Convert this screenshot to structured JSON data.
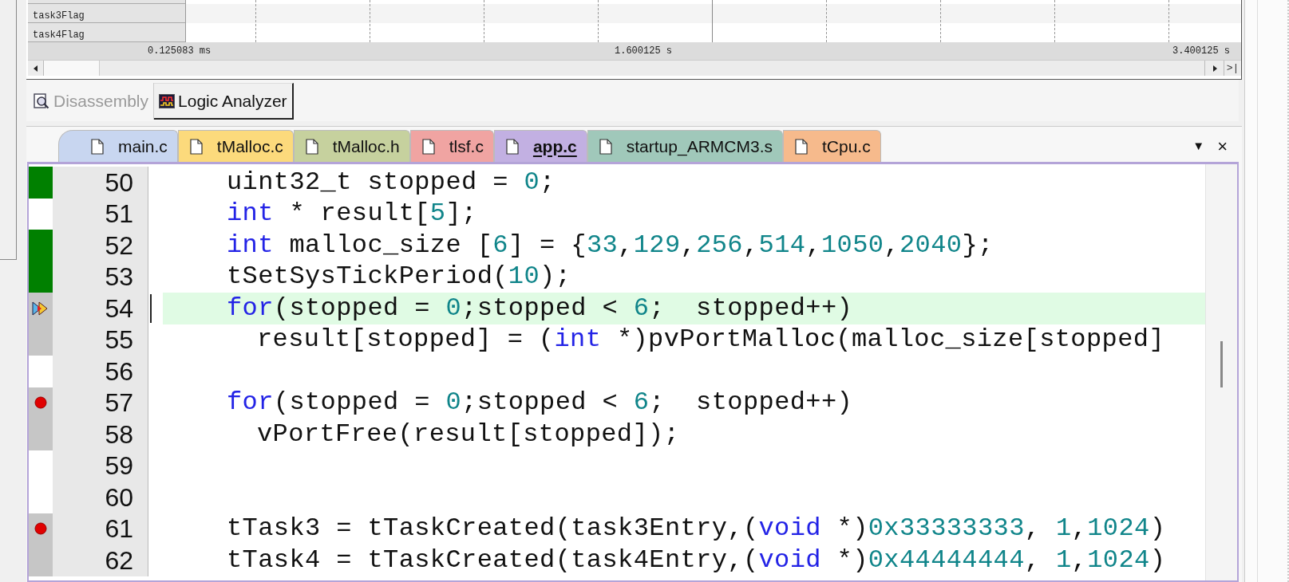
{
  "logic_analyzer": {
    "signals": [
      "task3Flag",
      "task4Flag"
    ],
    "time_labels": [
      "0.125083 ms",
      "1.600125 s",
      "3.400125 s"
    ],
    "scroll_end": ">|"
  },
  "panel_tabs": [
    {
      "label": "Disassembly",
      "selected": false,
      "kind": "disassembly"
    },
    {
      "label": "Logic Analyzer",
      "selected": true,
      "kind": "analyzer"
    }
  ],
  "editor_tabs": [
    {
      "label": "main.c",
      "selected": false,
      "color": "#c8d6f0"
    },
    {
      "label": "tMalloc.c",
      "selected": false,
      "color": "#fcda7c"
    },
    {
      "label": "tMalloc.h",
      "selected": false,
      "color": "#c6d19e"
    },
    {
      "label": "tlsf.c",
      "selected": false,
      "color": "#f0a4a2"
    },
    {
      "label": "app.c",
      "selected": true,
      "color": "#c2b0e2"
    },
    {
      "label": "startup_ARMCM3.s",
      "selected": false,
      "color": "#a0c8ba"
    },
    {
      "label": "tCpu.c",
      "selected": false,
      "color": "#f6ba8c"
    }
  ],
  "tab_controls": {
    "dropdown": "▼",
    "close": "×"
  },
  "lines": [
    {
      "number": "50",
      "kind": "statement",
      "covered": true,
      "breakpoint": false,
      "current": false,
      "segments": [
        {
          "text": "uint32_t stopped = ",
          "kind": "plain"
        },
        {
          "text": "0",
          "kind": "number"
        },
        {
          "text": ";",
          "kind": "plain"
        }
      ]
    },
    {
      "number": "51",
      "kind": "statement",
      "covered": false,
      "executed": false,
      "breakpoint": false,
      "current": false,
      "segments": [
        {
          "text": "int",
          "kind": "keyword"
        },
        {
          "text": " * result[",
          "kind": "plain"
        },
        {
          "text": "5",
          "kind": "number"
        },
        {
          "text": "];",
          "kind": "plain"
        }
      ]
    },
    {
      "number": "52",
      "kind": "statement",
      "covered": true,
      "breakpoint": false,
      "current": false,
      "segments": [
        {
          "text": "int",
          "kind": "keyword"
        },
        {
          "text": " malloc_size [",
          "kind": "plain"
        },
        {
          "text": "6",
          "kind": "number"
        },
        {
          "text": "] = {",
          "kind": "plain"
        },
        {
          "text": "33",
          "kind": "number"
        },
        {
          "text": ",",
          "kind": "plain"
        },
        {
          "text": "129",
          "kind": "number"
        },
        {
          "text": ",",
          "kind": "plain"
        },
        {
          "text": "256",
          "kind": "number"
        },
        {
          "text": ",",
          "kind": "plain"
        },
        {
          "text": "514",
          "kind": "number"
        },
        {
          "text": ",",
          "kind": "plain"
        },
        {
          "text": "1050",
          "kind": "number"
        },
        {
          "text": ",",
          "kind": "plain"
        },
        {
          "text": "2040",
          "kind": "number"
        },
        {
          "text": "};",
          "kind": "plain"
        }
      ]
    },
    {
      "number": "53",
      "kind": "statement",
      "covered": true,
      "breakpoint": false,
      "current": false,
      "segments": [
        {
          "text": "tSetSysTickPeriod(",
          "kind": "plain"
        },
        {
          "text": "10",
          "kind": "number"
        },
        {
          "text": ");",
          "kind": "plain"
        }
      ]
    },
    {
      "number": "54",
      "kind": "statement",
      "covered": false,
      "executed": true,
      "breakpoint": false,
      "current": true,
      "segments": [
        {
          "text": "for",
          "kind": "keyword"
        },
        {
          "text": "(stopped = ",
          "kind": "plain"
        },
        {
          "text": "0",
          "kind": "number"
        },
        {
          "text": ";stopped < ",
          "kind": "plain"
        },
        {
          "text": "6",
          "kind": "number"
        },
        {
          "text": ";  stopped++)",
          "kind": "plain"
        }
      ]
    },
    {
      "number": "55",
      "kind": "loop_body",
      "covered": false,
      "executed": true,
      "breakpoint": false,
      "current": false,
      "segments": [
        {
          "text": "result[stopped] = (",
          "kind": "plain"
        },
        {
          "text": "int",
          "kind": "keyword"
        },
        {
          "text": " *)pvPortMalloc(malloc_size[stopped]",
          "kind": "plain"
        }
      ]
    },
    {
      "number": "56",
      "kind": "statement",
      "covered": false,
      "executed": false,
      "breakpoint": false,
      "current": false
    },
    {
      "number": "57",
      "kind": "statement",
      "covered": false,
      "executed": true,
      "breakpoint": true,
      "current": false,
      "segments": [
        {
          "text": "for",
          "kind": "keyword"
        },
        {
          "text": "(stopped = ",
          "kind": "plain"
        },
        {
          "text": "0",
          "kind": "number"
        },
        {
          "text": ";stopped < ",
          "kind": "plain"
        },
        {
          "text": "6",
          "kind": "number"
        },
        {
          "text": ";  stopped++)",
          "kind": "plain"
        }
      ]
    },
    {
      "number": "58",
      "kind": "loop_body",
      "covered": false,
      "executed": true,
      "breakpoint": false,
      "current": false,
      "segments": [
        {
          "text": "vPortFree(result[stopped]);",
          "kind": "plain"
        }
      ]
    },
    {
      "number": "59",
      "kind": "statement",
      "covered": false,
      "executed": false,
      "breakpoint": false,
      "current": false
    },
    {
      "number": "60",
      "kind": "statement",
      "covered": false,
      "executed": false,
      "breakpoint": false,
      "current": false
    },
    {
      "number": "61",
      "kind": "statement",
      "covered": false,
      "executed": true,
      "breakpoint": true,
      "current": false,
      "segments": [
        {
          "text": "tTask3 = tTaskCreated(task3Entry,(",
          "kind": "plain"
        },
        {
          "text": "void",
          "kind": "keyword"
        },
        {
          "text": " *)",
          "kind": "plain"
        },
        {
          "text": "0x33333333",
          "kind": "number"
        },
        {
          "text": ", ",
          "kind": "plain"
        },
        {
          "text": "1",
          "kind": "number"
        },
        {
          "text": ",",
          "kind": "plain"
        },
        {
          "text": "1024",
          "kind": "number"
        },
        {
          "text": ")",
          "kind": "plain"
        }
      ]
    },
    {
      "number": "62",
      "kind": "statement",
      "covered": false,
      "executed": true,
      "breakpoint": false,
      "current": false,
      "segments": [
        {
          "text": "tTask4 = tTaskCreated(task4Entry,(",
          "kind": "plain"
        },
        {
          "text": "void",
          "kind": "keyword"
        },
        {
          "text": " *)",
          "kind": "plain"
        },
        {
          "text": "0x44444444",
          "kind": "number"
        },
        {
          "text": ", ",
          "kind": "plain"
        },
        {
          "text": "1",
          "kind": "number"
        },
        {
          "text": ",",
          "kind": "plain"
        },
        {
          "text": "1024",
          "kind": "number"
        },
        {
          "text": ")",
          "kind": "plain"
        }
      ]
    }
  ]
}
